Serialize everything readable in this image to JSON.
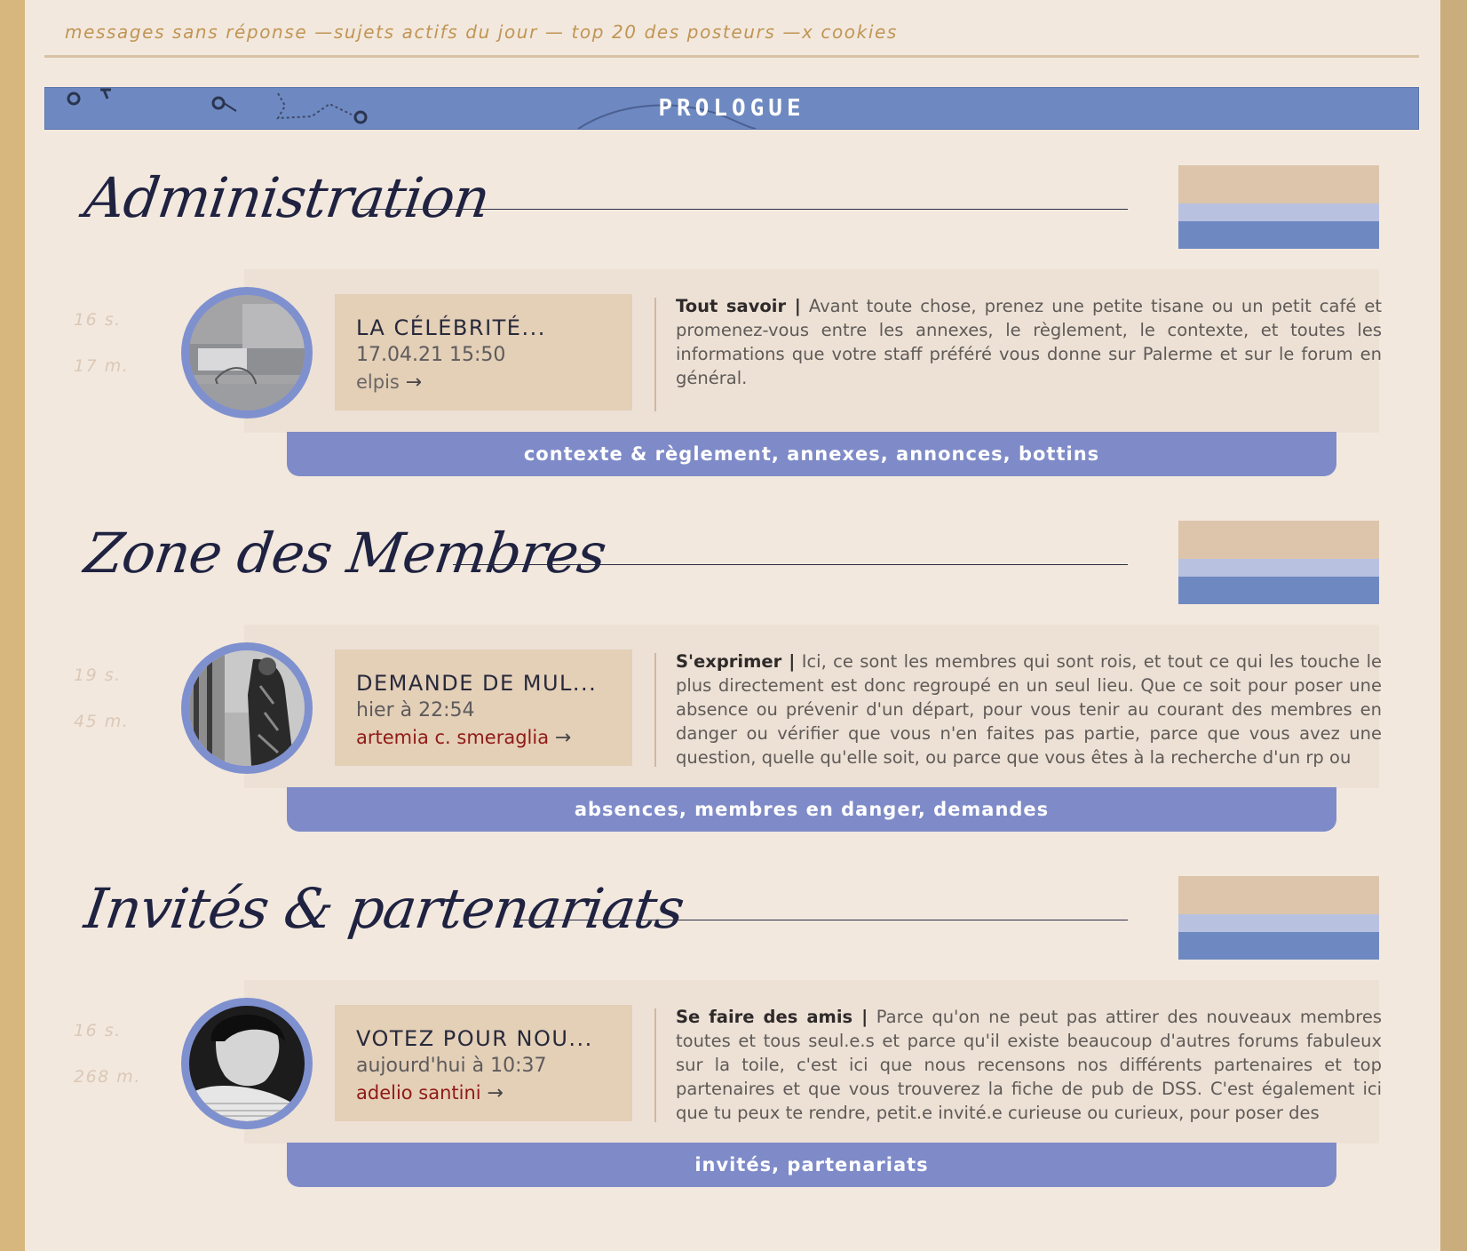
{
  "quicklinks": {
    "unanswered": "messages sans réponse",
    "sep1": "—",
    "active": "sujets actifs du jour",
    "sep2": "—",
    "top_posters": "top 20 des posteurs",
    "sep3": "—",
    "cookies": "x cookies"
  },
  "banner": {
    "title": "PROLOGUE"
  },
  "sections": [
    {
      "title": "Administration",
      "stats": {
        "topics": "16 s.",
        "messages": "17 m."
      },
      "last_post": {
        "title": "LA CÉLÉBRITÉ...",
        "date": "17.04.21 15:50",
        "author": "elpis",
        "arrow": "→",
        "author_color": "#6a6766"
      },
      "description_lead": "Tout savoir |",
      "description": "Avant toute chose, prenez une petite tisane ou un petit café et promenez-vous entre les annexes, le règlement, le contexte, et toutes les informations que votre staff préféré vous donne sur Palerme et sur le forum en général.",
      "subforums": "contexte & règlement, annexes, annonces, bottins",
      "avatar_icon": "avatar-collage"
    },
    {
      "title": "Zone des Membres",
      "stats": {
        "topics": "19 s.",
        "messages": "45 m."
      },
      "last_post": {
        "title": "DEMANDE DE MUL...",
        "date": "hier à 22:54",
        "author": "artemia c. smeraglia",
        "arrow": "→",
        "author_color": "#8f1a16"
      },
      "description_lead": "S'exprimer |",
      "description": "Ici, ce sont les membres qui sont rois, et tout ce qui les touche le plus directement est donc regroupé en un seul lieu. Que ce soit pour poser une absence ou prévenir d'un départ, pour vous tenir au courant des membres en danger ou vérifier que vous n'en faites pas partie, parce que vous avez une question, quelle qu'elle soit, ou parce que vous êtes à la recherche d'un rp ou",
      "subforums": "absences, membres en danger, demandes",
      "avatar_icon": "avatar-woman-coat"
    },
    {
      "title": "Invités & partenariats",
      "stats": {
        "topics": "16 s.",
        "messages": "268 m."
      },
      "last_post": {
        "title": "VOTEZ POUR NOU...",
        "date": "aujourd'hui à 10:37",
        "author": "adelio santini",
        "arrow": "→",
        "author_color": "#8f1a16"
      },
      "description_lead": "Se faire des amis |",
      "description": "Parce qu'on ne peut pas attirer des nouveaux membres toutes et tous seul.e.s et parce qu'il existe beaucoup d'autres forums fabuleux sur la toile, c'est ici que nous recensons nos différents partenaires et top partenaires et que vous trouverez la fiche de pub de DSS. C'est également ici que tu peux te rendre, petit.e invité.e curieuse ou curieux, pour poser des",
      "subforums": "invités, partenariats",
      "avatar_icon": "avatar-portrait-man"
    }
  ],
  "colors": {
    "accent_blue": "#6e89c1",
    "tab_blue": "#7f8bc8",
    "link_gold": "#c09554",
    "author_red": "#8f1a16"
  }
}
